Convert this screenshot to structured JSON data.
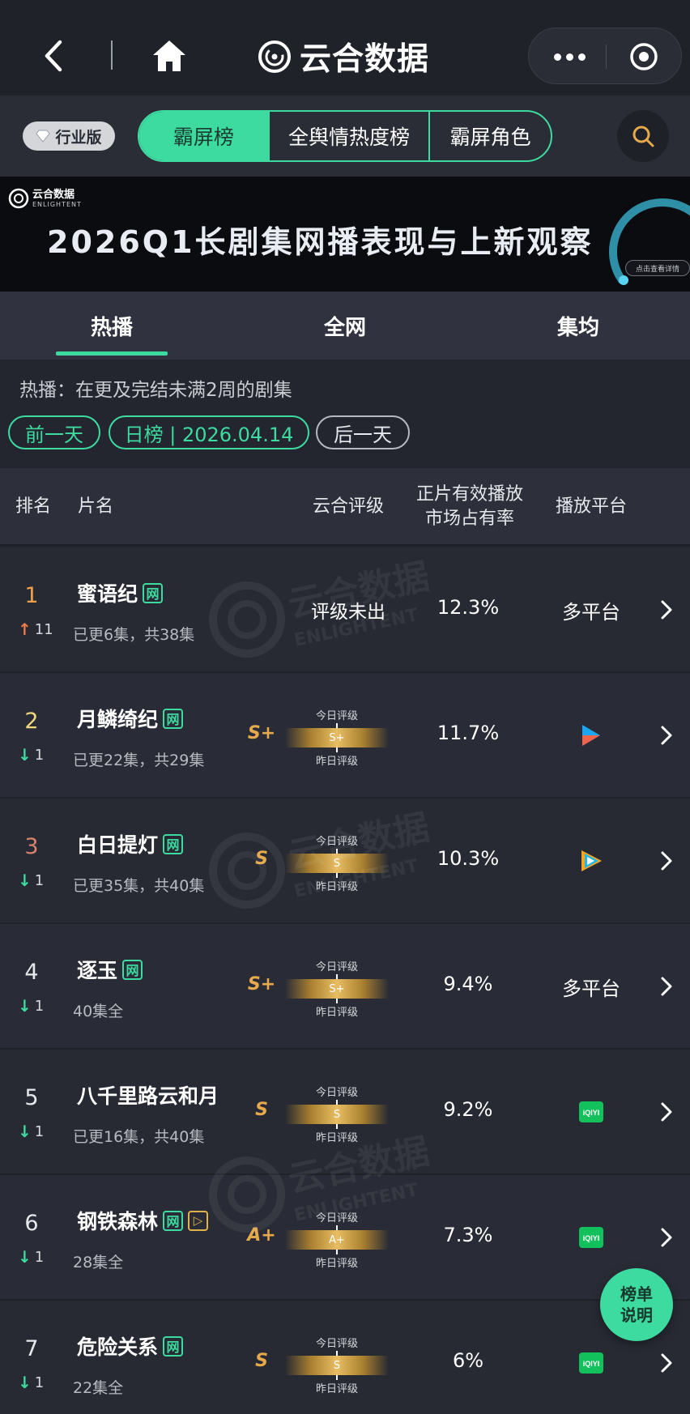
{
  "nav": {
    "app_title": "云合数据",
    "icons": {
      "back": "chevron-left-icon",
      "home": "home-icon",
      "more": "more-dots-icon",
      "close": "target-close-icon"
    }
  },
  "toolbar": {
    "edition_badge": "行业版",
    "tabs": [
      {
        "label": "霸屏榜",
        "active": true
      },
      {
        "label": "全舆情热度榜",
        "active": false
      },
      {
        "label": "霸屏角色",
        "active": false
      }
    ],
    "search_icon": "search-icon"
  },
  "banner": {
    "logo_text": "云合数据",
    "logo_sub": "ENLIGHTENT",
    "title": "2026Q1长剧集网播表现与上新观察",
    "cta": "点击查看详情"
  },
  "subtabs": [
    {
      "label": "热播",
      "active": true
    },
    {
      "label": "全网",
      "active": false
    },
    {
      "label": "集均",
      "active": false
    }
  ],
  "filter": {
    "description": "热播：在更及完结未满2周的剧集",
    "prev_day": "前一天",
    "date_label": "日榜 | 2026.04.14",
    "next_day": "后一天"
  },
  "table": {
    "headers": {
      "rank": "排名",
      "title": "片名",
      "rating": "云合评级",
      "share_line1": "正片有效播放",
      "share_line2": "市场占有率",
      "platform": "播放平台"
    },
    "rows": [
      {
        "rank": "1",
        "change": "11",
        "direction": "up",
        "title": "蜜语纪",
        "net_tag": "网",
        "episodes": "已更6集，共38集",
        "rating_text": "评级未出",
        "share": "12.3%",
        "platform": "多平台"
      },
      {
        "rank": "2",
        "change": "1",
        "direction": "down",
        "title": "月鳞绮纪",
        "net_tag": "网",
        "episodes": "已更22集，共29集",
        "grade": "S+",
        "today_label": "今日评级",
        "yesterday_label": "昨日评级",
        "share": "11.7%",
        "platform_icon": "youku-icon"
      },
      {
        "rank": "3",
        "change": "1",
        "direction": "down",
        "title": "白日提灯",
        "net_tag": "网",
        "episodes": "已更35集，共40集",
        "grade": "S",
        "today_label": "今日评级",
        "yesterday_label": "昨日评级",
        "share": "10.3%",
        "platform_icon": "tencent-video-icon"
      },
      {
        "rank": "4",
        "change": "1",
        "direction": "down",
        "title": "逐玉",
        "net_tag": "网",
        "episodes": "40集全",
        "grade": "S+",
        "today_label": "今日评级",
        "yesterday_label": "昨日评级",
        "share": "9.4%",
        "platform": "多平台"
      },
      {
        "rank": "5",
        "change": "1",
        "direction": "down",
        "title": "八千里路云和月",
        "episodes": "已更16集，共40集",
        "grade": "S",
        "today_label": "今日评级",
        "yesterday_label": "昨日评级",
        "share": "9.2%",
        "platform_icon": "iqiyi-icon",
        "platform_icon_text": "iQIYI"
      },
      {
        "rank": "6",
        "change": "1",
        "direction": "down",
        "title": "钢铁森林",
        "net_tag": "网",
        "extra_tag": "▷",
        "episodes": "28集全",
        "grade": "A+",
        "today_label": "今日评级",
        "yesterday_label": "昨日评级",
        "share": "7.3%",
        "platform_icon": "iqiyi-icon",
        "platform_icon_text": "iQIYI"
      },
      {
        "rank": "7",
        "change": "1",
        "direction": "down",
        "title": "危险关系",
        "net_tag": "网",
        "episodes": "22集全",
        "grade": "S",
        "today_label": "今日评级",
        "yesterday_label": "昨日评级",
        "share": "6%",
        "platform_icon": "iqiyi-icon",
        "platform_icon_text": "iQIYI"
      }
    ]
  },
  "float_button": {
    "line1": "榜单",
    "line2": "说明"
  },
  "watermark": {
    "text": "云合数据",
    "sub": "ENLIGHTENT"
  },
  "colors": {
    "accent": "#3ddba0",
    "gold": "#e6a94b",
    "up": "#f0794a",
    "down": "#3ddba0",
    "rank1": "#f0a04a",
    "rank3": "#d9836b"
  }
}
